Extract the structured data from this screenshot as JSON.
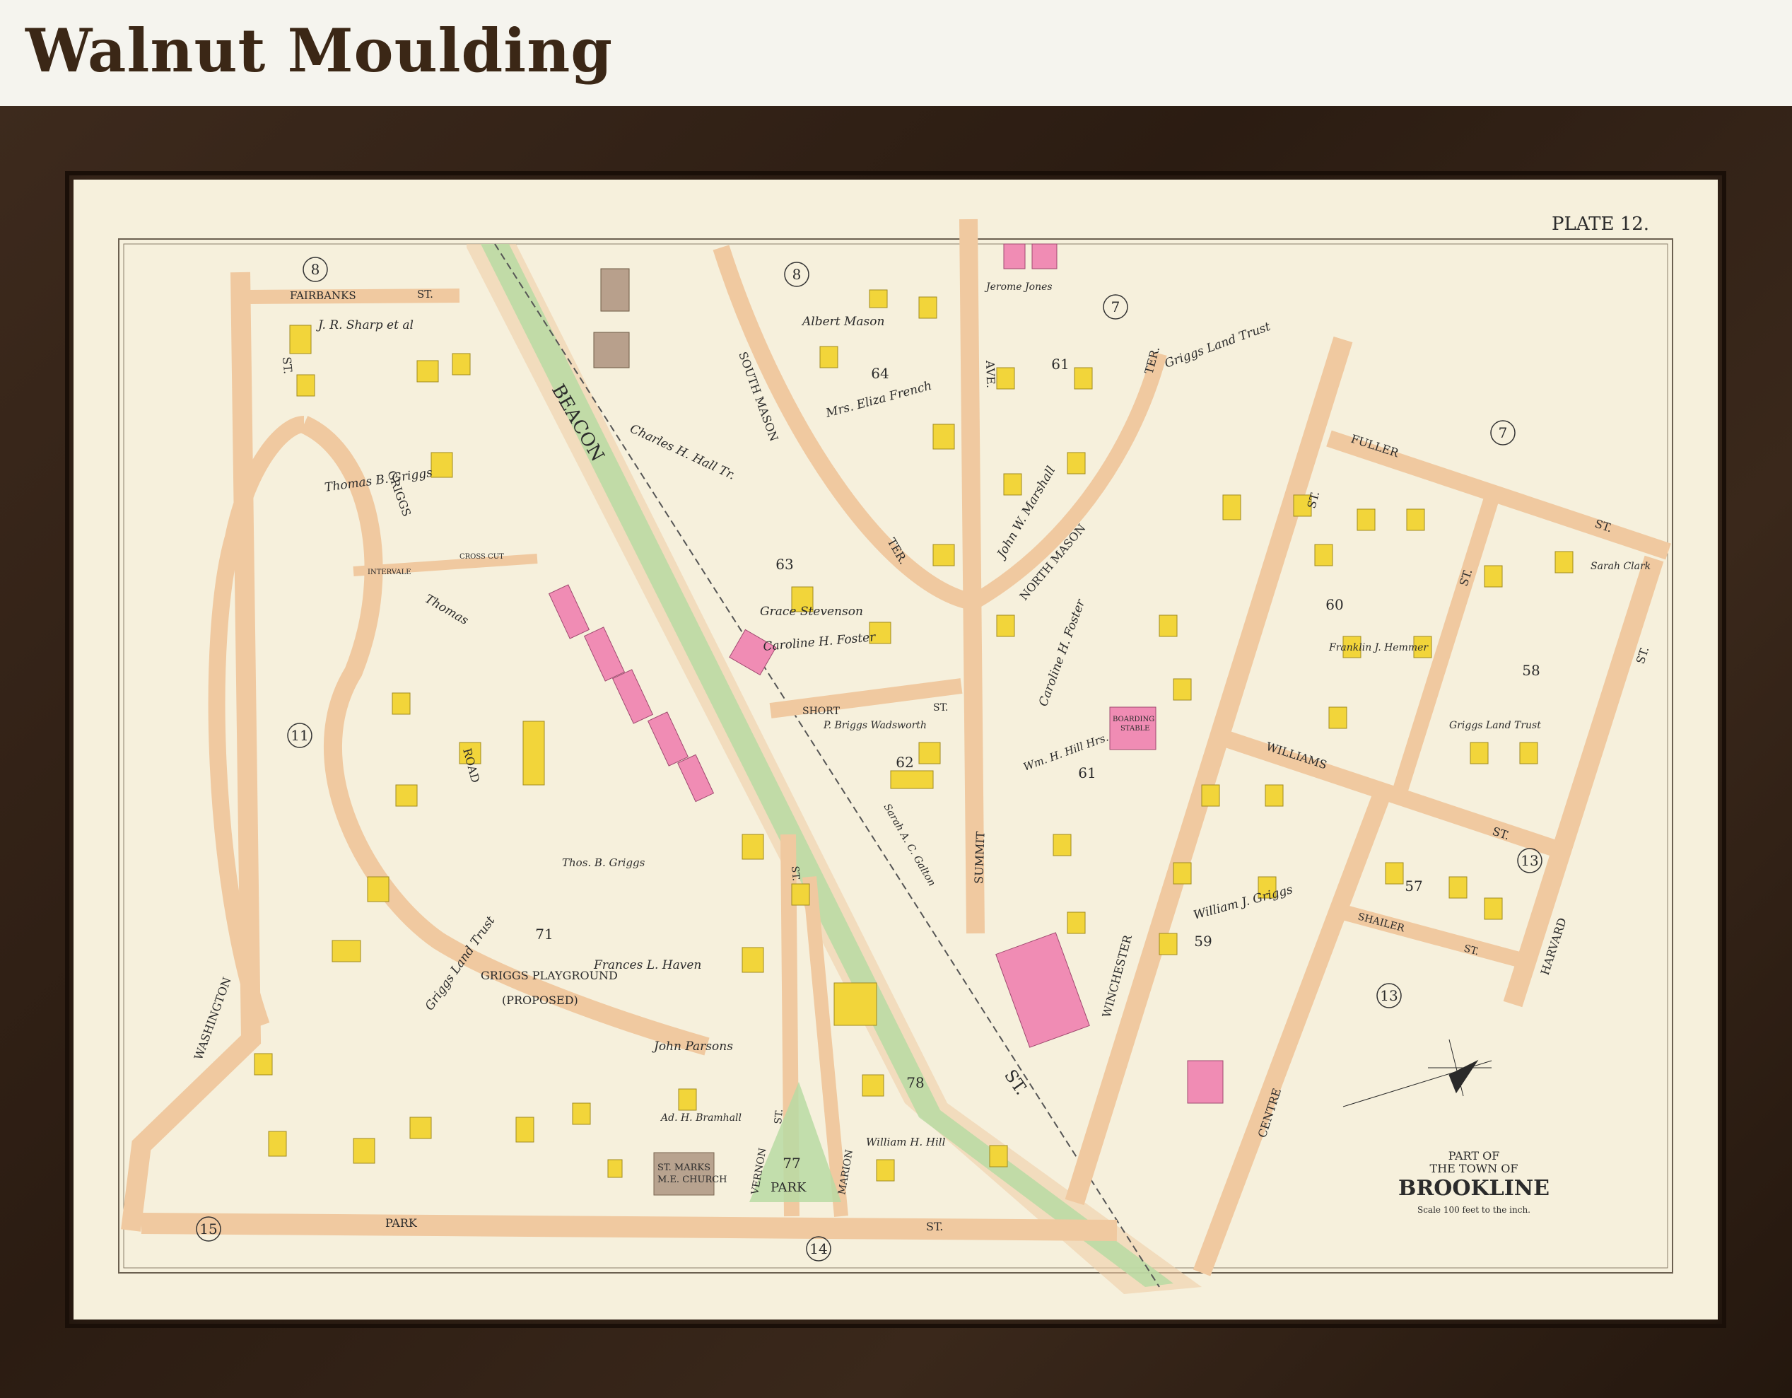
{
  "page_title": "Walnut Moulding",
  "map": {
    "plate": "PLATE 12.",
    "cartouche": {
      "line1": "PART OF",
      "line2": "THE TOWN OF",
      "line3": "BROOKLINE",
      "line4": "Scale 100 feet to the inch."
    },
    "streets": {
      "beacon": "BEACON",
      "beacon_st": "ST.",
      "fairbanks": "FAIRBANKS",
      "fairbanks_st": "ST.",
      "griggs_road": "GRIGGS",
      "road": "ROAD",
      "washington": "WASHINGTON",
      "washington_st": "ST.",
      "intervale": "INTERVALE",
      "cross_cut": "CROSS CUT",
      "park_st": "PARK",
      "park_st_st": "ST.",
      "vernon": "VERNON",
      "vernon_st": "ST.",
      "marion": "MARION",
      "marion_st": "ST.",
      "short_st": "SHORT",
      "short_st_st": "ST.",
      "south_mason": "SOUTH MASON",
      "ter": "TER.",
      "summit_ave": "SUMMIT",
      "ave": "AVE.",
      "north_mason": "NORTH MASON",
      "north_ter": "TER.",
      "winchester": "WINCHESTER",
      "winchester_st": "ST.",
      "centre": "CENTRE",
      "fuller": "FULLER",
      "fuller_st": "ST.",
      "williams": "WILLIAMS",
      "williams_st": "ST.",
      "shailer": "SHAILER",
      "shailer_st": "ST.",
      "harvard": "HARVARD",
      "harvard_st": "ST.",
      "st_mid": "ST."
    },
    "block_numbers": {
      "b8a": "8",
      "b8b": "8",
      "b7a": "7",
      "b7b": "7",
      "b11": "11",
      "b13a": "13",
      "b13b": "13",
      "b14": "14",
      "b15": "15",
      "n64": "64",
      "n63": "63",
      "n62": "62",
      "n61a": "61",
      "n61b": "61",
      "n60": "60",
      "n59": "59",
      "n58": "58",
      "n57": "57",
      "n71": "71",
      "n78": "78",
      "n77": "77"
    },
    "labels": {
      "playground": "GRIGGS PLAYGROUND",
      "proposed": "(PROPOSED)",
      "church1": "ST. MARKS",
      "church2": "M.E. CHURCH",
      "park": "PARK",
      "stable1": "BOARDING",
      "stable2": "STABLE"
    },
    "owners": {
      "sharp": "J. R. Sharp et al",
      "thomas_griggs": "Thomas B. Griggs",
      "thomas": "Thomas",
      "griggs_land_trust": "Griggs Land Trust",
      "albert_mason": "Albert Mason",
      "charles_hall": "Charles H. Hall Tr.",
      "eliza_french": "Mrs. Eliza French",
      "grace_stevenson": "Grace Stevenson",
      "caroline_foster": "Caroline H. Foster",
      "p_briggs": "P. Briggs Wadsworth",
      "jerome_jones": "Jerome Jones",
      "john_marshall": "John W. Marshall",
      "caroline_foster2": "Caroline H. Foster",
      "wm_hill": "Wm. H. Hill Hrs.",
      "griggs_land_trust2": "Griggs Land Trust",
      "frances_haven": "Frances L. Haven",
      "john_parsons": "John Parsons",
      "ad_bramhall": "Ad. H. Bramhall",
      "thos_griggs2": "Thos. B. Griggs",
      "william_hill": "William H. Hill",
      "sarah_griggs": "Sarah A. C. Galton",
      "william_griggs": "William J. Griggs",
      "franklin_hemmer": "Franklin J. Hemmer",
      "griggs_land_trust3": "Griggs Land Trust",
      "sarah_clark": "Sarah Clark"
    }
  }
}
